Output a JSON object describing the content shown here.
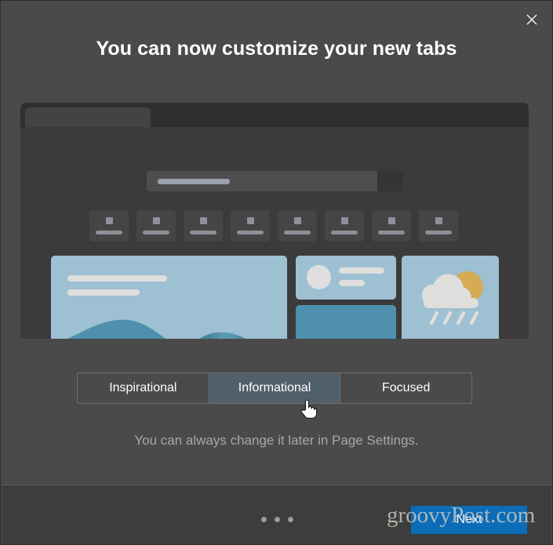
{
  "dialog": {
    "title": "You can now customize your new tabs",
    "close_label": "Close",
    "close_icon": "close-icon"
  },
  "preview": {
    "search_placeholder_text": "",
    "tiles_count": 8,
    "cards": {
      "hero": {
        "kind": "image-article"
      },
      "profile": {
        "kind": "profile-snippet"
      },
      "block": {
        "kind": "solid-block"
      },
      "weather": {
        "kind": "weather-rain-sun"
      }
    }
  },
  "theme_selector": {
    "options": [
      {
        "label": "Inspirational",
        "selected": false
      },
      {
        "label": "Informational",
        "selected": true
      },
      {
        "label": "Focused",
        "selected": false
      }
    ],
    "selected_color": "#50606b"
  },
  "helper_text": "You can always change it later in Page Settings.",
  "footer": {
    "dots": [
      {
        "active": true
      },
      {
        "active": false
      },
      {
        "active": false
      }
    ],
    "next_label": "Next",
    "next_color": "#0b6cb8"
  },
  "watermark": {
    "text": "groovyPost.com"
  },
  "colors": {
    "dialog_bg": "#4a4a4a",
    "footer_bg": "#3d3d3d",
    "preview_bg": "#3b3b3b",
    "accent_blue": "#0b6cb8",
    "card_blue": "#9dc0d2",
    "card_blue_dark": "#4e90ad"
  }
}
